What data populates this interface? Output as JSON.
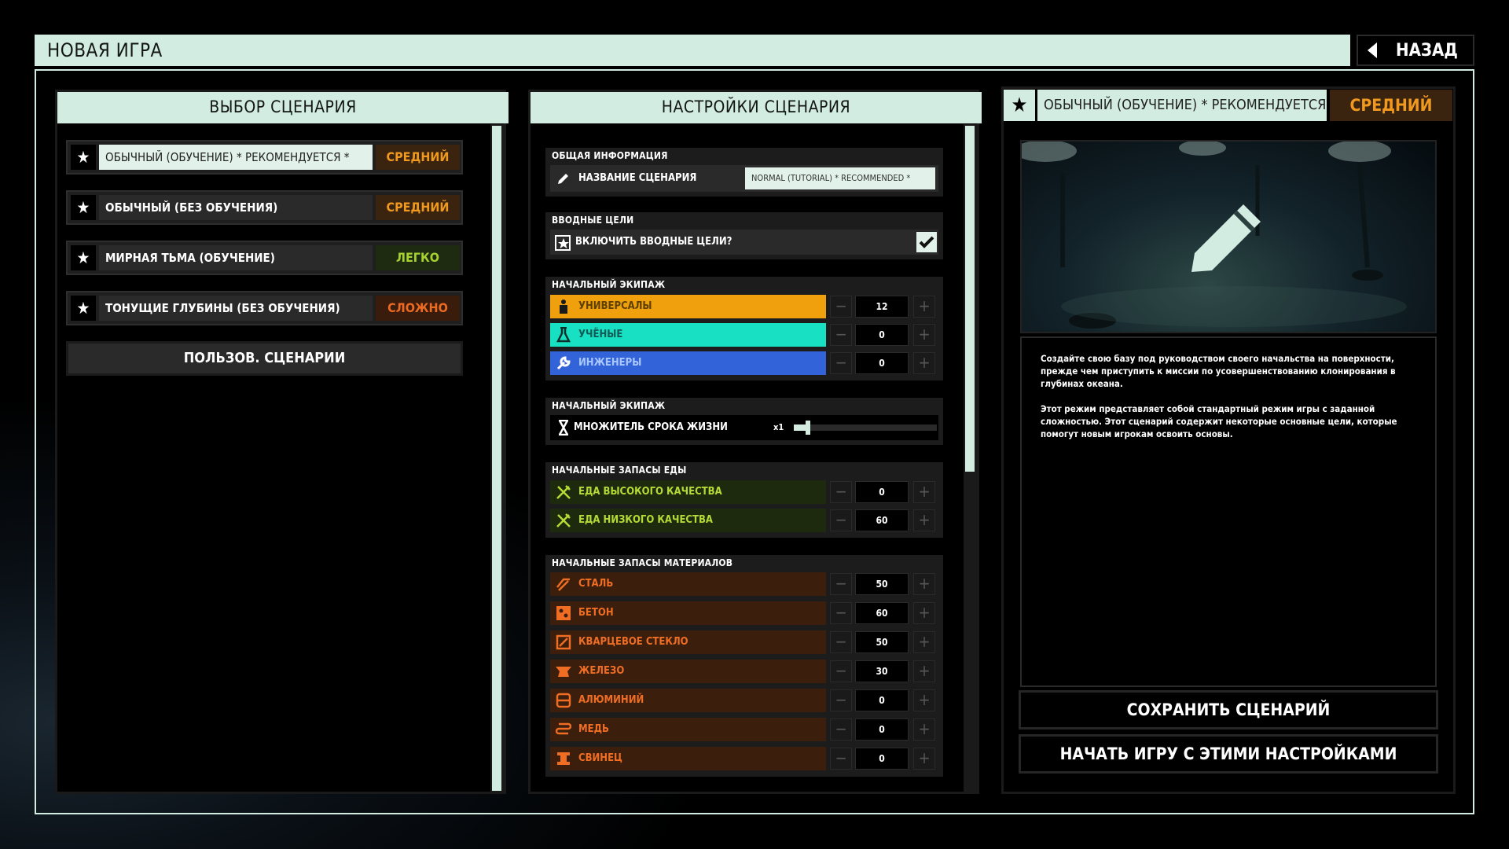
{
  "header": {
    "title": "НОВАЯ ИГРА",
    "back_label": "НАЗАД"
  },
  "left": {
    "title": "ВЫБОР СЦЕНАРИЯ",
    "scenarios": [
      {
        "name": "ОБЫЧНЫЙ (ОБУЧЕНИЕ) * РЕКОМЕНДУЕТСЯ *",
        "difficulty": "СРЕДНИЙ"
      },
      {
        "name": "ОБЫЧНЫЙ (БЕЗ ОБУЧЕНИЯ)",
        "difficulty": "СРЕДНИЙ"
      },
      {
        "name": "МИРНАЯ ТЬМА (ОБУЧЕНИЕ)",
        "difficulty": "ЛЕГКО"
      },
      {
        "name": "ТОНУЩИЕ ГЛУБИНЫ (БЕЗ ОБУЧЕНИЯ)",
        "difficulty": "СЛОЖНО"
      }
    ],
    "custom_label": "ПОЛЬЗОВ. СЦЕНАРИИ"
  },
  "middle": {
    "title": "НАСТРОЙКИ СЦЕНАРИЯ",
    "general": {
      "title": "ОБЩАЯ ИНФОРМАЦИЯ",
      "name_label": "НАЗВАНИЕ СЦЕНАРИЯ",
      "name_value": "NORMAL (TUTORIAL) * RECOMMENDED *"
    },
    "intro": {
      "title": "ВВОДНЫЕ ЦЕЛИ",
      "label": "ВКЛЮЧИТЬ ВВОДНЫЕ ЦЕЛИ?",
      "checked": true
    },
    "crew": {
      "title": "НАЧАЛЬНЫЙ ЭКИПАЖ",
      "rows": [
        {
          "label": "УНИВЕРСАЛЫ",
          "value": "12"
        },
        {
          "label": "УЧЁНЫЕ",
          "value": "0"
        },
        {
          "label": "ИНЖЕНЕРЫ",
          "value": "0"
        }
      ]
    },
    "life": {
      "title": "НАЧАЛЬНЫЙ ЭКИПАЖ",
      "label": "МНОЖИТЕЛЬ СРОКА ЖИЗНИ",
      "value": "x1",
      "slider_level": 0.1
    },
    "food": {
      "title": "НАЧАЛЬНЫЕ ЗАПАСЫ ЕДЫ",
      "rows": [
        {
          "label": "ЕДА ВЫСОКОГО КАЧЕСТВА",
          "value": "0"
        },
        {
          "label": "ЕДА НИЗКОГО КАЧЕСТВА",
          "value": "60"
        }
      ]
    },
    "materials": {
      "title": "НАЧАЛЬНЫЕ ЗАПАСЫ МАТЕРИАЛОВ",
      "rows": [
        {
          "label": "СТАЛЬ",
          "value": "50"
        },
        {
          "label": "БЕТОН",
          "value": "60"
        },
        {
          "label": "КВАРЦЕВОЕ СТЕКЛО",
          "value": "50"
        },
        {
          "label": "ЖЕЛЕЗО",
          "value": "30"
        },
        {
          "label": "АЛЮМИНИЙ",
          "value": "0"
        },
        {
          "label": "МЕДЬ",
          "value": "0"
        },
        {
          "label": "СВИНЕЦ",
          "value": "0"
        }
      ]
    }
  },
  "right": {
    "name": "ОБЫЧНЫЙ (ОБУЧЕНИЕ) * РЕКОМЕНДУЕТСЯ *",
    "difficulty": "СРЕДНИЙ",
    "description": [
      "Создайте свою базу под руководством своего начальства на поверхности, прежде чем приступить к миссии по усовершенствованию клонирования в глубинах океана.",
      "Этот режим представляет собой стандартный режим игры с заданной сложностью. Этот сценарий содержит некоторые основные цели, которые помогут новым игрокам освоить основы."
    ],
    "save_label": "СОХРАНИТЬ СЦЕНАРИЙ",
    "start_label": "НАЧАТЬ ИГРУ С ЭТИМИ НАСТРОЙКАМИ"
  },
  "colors": {
    "accent": "#d3ece2",
    "medium": "#f0991e",
    "easy": "#a6d231",
    "hard": "#ec6a22",
    "generalists": "#efa00c",
    "scientists": "#18e0c2",
    "engineers": "#3363d8"
  }
}
